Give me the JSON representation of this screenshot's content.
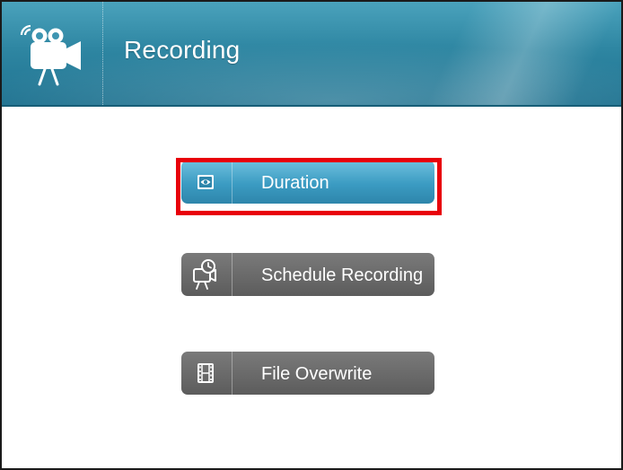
{
  "header": {
    "title": "Recording",
    "logo_icon": "video-camera-icon",
    "accent_color": "#2e86a2"
  },
  "menu": {
    "items": [
      {
        "label": "Duration",
        "icon": "eye-icon",
        "selected": true
      },
      {
        "label": "Schedule Recording",
        "icon": "camera-clock-icon",
        "selected": false
      },
      {
        "label": "File Overwrite",
        "icon": "film-strip-icon",
        "selected": false
      }
    ],
    "selected_color": "#3b9bc2",
    "default_color": "#666666",
    "focus_color": "#e8000a"
  }
}
